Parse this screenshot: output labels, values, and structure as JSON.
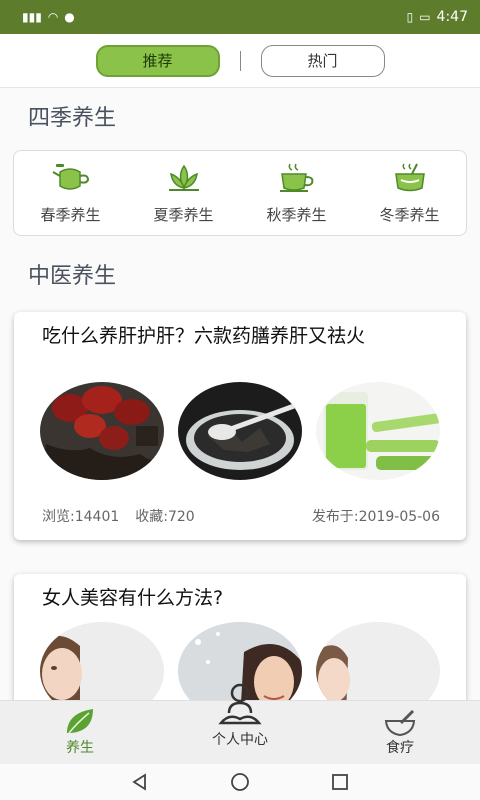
{
  "status_bar": {
    "signal": "⁴ᴳ.ıll",
    "time": "4:47"
  },
  "tabs": [
    {
      "label": "推荐"
    },
    {
      "label": "热门"
    }
  ],
  "sections": {
    "seasons_title": "四季养生",
    "tcm_title": "中医养生"
  },
  "seasons": [
    {
      "label": "春季养生",
      "icon": "teapot-icon"
    },
    {
      "label": "夏季养生",
      "icon": "lotus-icon"
    },
    {
      "label": "秋季养生",
      "icon": "tea-cup-icon"
    },
    {
      "label": "冬季养生",
      "icon": "hot-pot-icon"
    }
  ],
  "articles": [
    {
      "title": "吃什么养肝护肝？六款药膳养肝又祛火",
      "views": "浏览:14401",
      "favorites": "收藏:720",
      "date": "发布于:2019-05-06"
    },
    {
      "title": "女人美容有什么方法?"
    }
  ],
  "bottom_nav": [
    {
      "label": "养生",
      "icon": "leaf-icon"
    },
    {
      "label": "个人中心",
      "icon": "meditation-icon"
    },
    {
      "label": "食疗",
      "icon": "mortar-icon"
    }
  ],
  "colors": {
    "accent": "#8ac24a",
    "status_bar": "#5d7d2c",
    "accent_dark": "#4f8a2a"
  }
}
